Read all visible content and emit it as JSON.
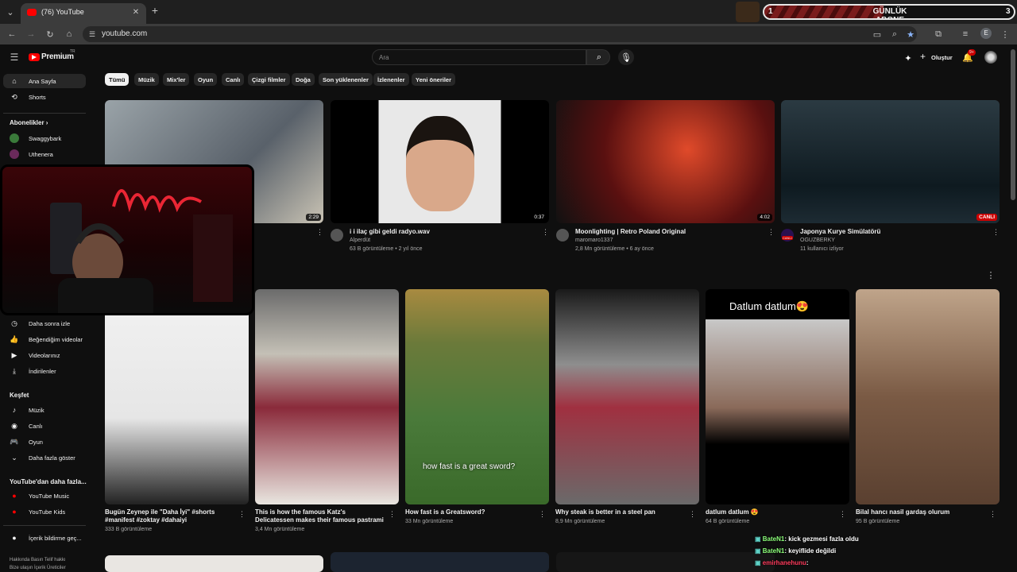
{
  "browser": {
    "tab_title": "(76) YouTube",
    "url": "youtube.com",
    "profile_letter": "E"
  },
  "overlay_banner": {
    "left_number": "1",
    "title": "GÜNLÜK ABONE",
    "right_number": "3"
  },
  "youtube": {
    "logo_text": "Premium",
    "logo_badge": "TR",
    "search_placeholder": "Ara",
    "create_label": "Oluştur",
    "notification_count": "9+",
    "chips": [
      "Tümü",
      "Müzik",
      "Mix'ler",
      "Oyun",
      "Canlı",
      "Çizgi filmler",
      "Doğa",
      "Son yüklenenler",
      "İzlenenler",
      "Yeni öneriler"
    ],
    "sidebar": {
      "main": [
        {
          "label": "Ana Sayfa",
          "icon": "home-icon"
        },
        {
          "label": "Shorts",
          "icon": "shorts-icon"
        }
      ],
      "subscriptions_title": "Abonelikler",
      "subscriptions": [
        "Swaggybark",
        "Uthenera"
      ],
      "you_items": [
        {
          "label": "Daha sonra izle",
          "icon": "clock-icon"
        },
        {
          "label": "Beğendiğim videolar",
          "icon": "thumbs-up-icon"
        },
        {
          "label": "Videolarınız",
          "icon": "video-icon"
        },
        {
          "label": "İndirilenler",
          "icon": "download-icon"
        }
      ],
      "explore_title": "Keşfet",
      "explore": [
        {
          "label": "Müzik",
          "icon": "music-icon"
        },
        {
          "label": "Canlı",
          "icon": "live-icon"
        },
        {
          "label": "Oyun",
          "icon": "gamepad-icon"
        },
        {
          "label": "Daha fazla göster",
          "icon": "chevron-down-icon"
        }
      ],
      "more_title": "YouTube'dan daha fazla...",
      "more": [
        {
          "label": "YouTube Music",
          "icon": "youtube-music-icon"
        },
        {
          "label": "YouTube Kids",
          "icon": "youtube-kids-icon"
        }
      ],
      "report": "İçerik bildirme geç...",
      "footer_line1": "Hakkında  Basın  Telif hakkı",
      "footer_line2": "Bize ulaşın  İçerik Üreticiler"
    },
    "videos": [
      {
        "title": "",
        "channel": "",
        "meta": "",
        "duration": "2:29"
      },
      {
        "title": "i i ilaç gibi geldi radyo.wav",
        "channel": "Alperdüt",
        "meta": "63 B görüntüleme • 2 yıl önce",
        "duration": "0:37"
      },
      {
        "title": "Moonlighting | Retro Poland Original",
        "channel": "maromaro1337",
        "meta": "2,8 Mn görüntüleme • 6 ay önce",
        "duration": "4:02"
      },
      {
        "title": "Japonya Kurye Simülatörü",
        "channel": "OGUZBERKY",
        "meta": "11 kullanıcı izliyor",
        "live_label": "CANLI",
        "avatar_label": "CANLI"
      }
    ],
    "shorts": [
      {
        "title": "Bugün Zeynep ile \"Daha İyi\" #shorts #manifest #zoktay #dahaiyi",
        "meta": "333 B görüntüleme"
      },
      {
        "title": "This is how the famous Katz's Delicatessen makes their famous pastrami sandwich! 📦 ...",
        "meta": "3,4 Mn görüntüleme"
      },
      {
        "title": "How fast is a Greatsword?",
        "meta": "33 Mn görüntüleme",
        "caption": "how fast is a great sword?"
      },
      {
        "title": "Why steak is better in a steel pan",
        "meta": "8,9 Mn görüntüleme"
      },
      {
        "title": "datlum datlum 😍",
        "meta": "64 B görüntüleme",
        "caption": "Datlum datlum😍"
      },
      {
        "title": "Bilal hancı nasil gardaş olurum",
        "meta": "95 B görüntüleme"
      }
    ]
  },
  "chat": [
    {
      "name": "BateN1",
      "message": "kick gezmesi fazla oldu"
    },
    {
      "name": "BateN1",
      "message": "keyiflide değildi"
    },
    {
      "name": "emirhanehunu",
      "message": ""
    }
  ],
  "colors": {
    "accent": "#ff0000",
    "live": "#cc0000",
    "background": "#0f0f0f",
    "chip": "#272727"
  }
}
